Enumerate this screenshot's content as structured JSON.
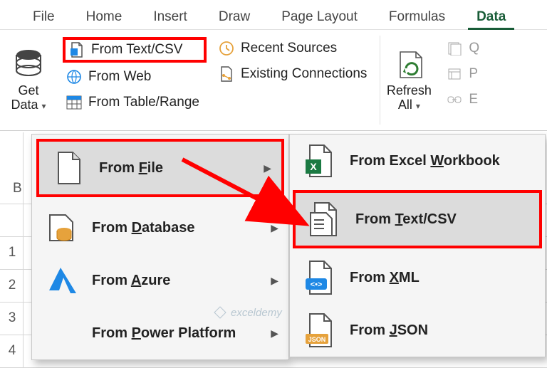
{
  "tabs": {
    "file": "File",
    "home": "Home",
    "insert": "Insert",
    "draw": "Draw",
    "pagelayout": "Page Layout",
    "formulas": "Formulas",
    "data": "Data"
  },
  "ribbon": {
    "getdata": "Get",
    "getdata2": "Data",
    "from_textcsv": "From Text/CSV",
    "from_web": "From Web",
    "from_tablerange": "From Table/Range",
    "recent_sources": "Recent Sources",
    "existing_conn": "Existing Connections",
    "refresh": "Refresh",
    "refresh2": "All",
    "q": "Q",
    "p": "P",
    "e": "E"
  },
  "menu1": {
    "from_file": "From File",
    "from_database": "From Database",
    "from_azure": "From Azure",
    "from_power": "From Power Platform"
  },
  "menu2": {
    "excel_wb": "From Excel Workbook",
    "text_csv": "From Text/CSV",
    "xml": "From XML",
    "json": "From JSON"
  },
  "colhead": {
    "b": "B"
  },
  "rowhead": {
    "r1": "1",
    "r2": "2",
    "r3": "3",
    "r4": "4"
  },
  "watermark": "exceldemy"
}
